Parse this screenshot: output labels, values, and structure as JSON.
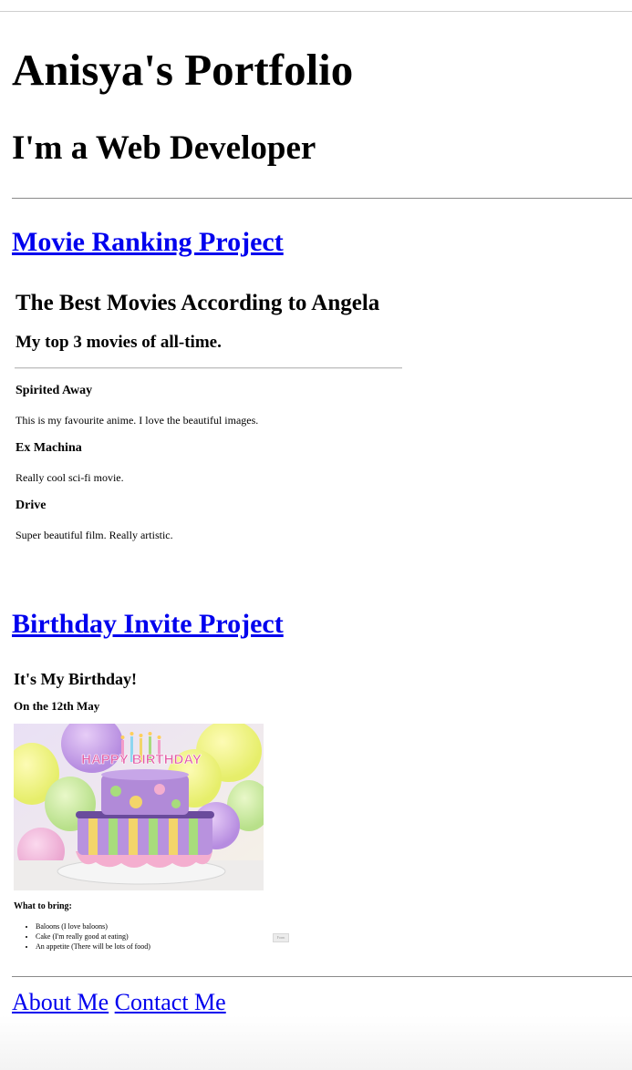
{
  "header": {
    "title": "Anisya's Portfolio",
    "subtitle": "I'm a Web Developer"
  },
  "projects": [
    {
      "link_label": "Movie Ranking Project",
      "embed": {
        "title": "The Best Movies According to Angela",
        "subtitle": "My top 3 movies of all-time.",
        "movies": [
          {
            "name": "Spirited Away",
            "description": "This is my favourite anime. I love the beautiful images."
          },
          {
            "name": "Ex Machina",
            "description": "Really cool sci-fi movie."
          },
          {
            "name": "Drive",
            "description": "Super beautiful film. Really artistic."
          }
        ]
      }
    },
    {
      "link_label": "Birthday Invite Project",
      "embed": {
        "title": "It's My Birthday!",
        "date": "On the 12th May",
        "cake_text": "HAPPY BIRTHDAY",
        "bring_heading": "What to bring:",
        "bring_items": [
          "Baloons (I love baloons)",
          "Cake (I'm really good at eating)",
          "An appetite (There will be lots of food)"
        ],
        "tiny_button": "Form"
      }
    }
  ],
  "footer": {
    "links": [
      "About Me",
      "Contact Me"
    ]
  },
  "colors": {
    "link": "#0000ee",
    "rule": "#8a8a8a"
  }
}
